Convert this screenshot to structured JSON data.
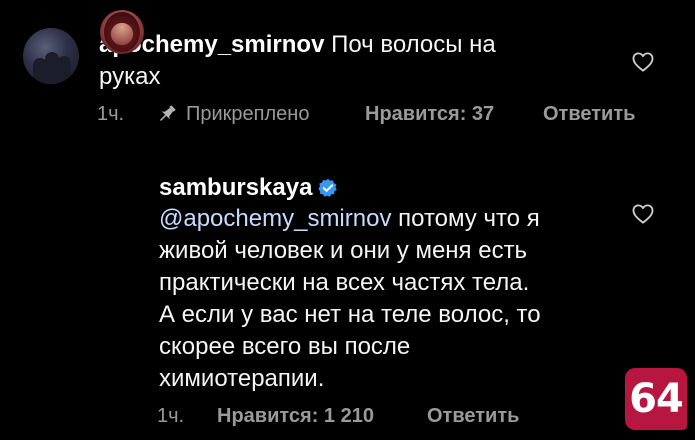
{
  "comment1": {
    "username": "apochemy_smirnov",
    "text_line1": " Поч волосы на",
    "text_line2": "руках",
    "time": "1ч.",
    "pinned_label": "Прикреплено",
    "likes": "Нравится: 37",
    "reply": "Ответить"
  },
  "comment2": {
    "username": "samburskaya",
    "mention": "@apochemy_smirnov",
    "lines": [
      " потому что я",
      "живой человек и они у меня есть",
      "практически на всех частях тела.",
      "А если у вас нет на теле волос, то",
      "скорее всего вы после",
      "химиотерапии."
    ],
    "time": "1ч.",
    "likes": "Нравится: 1 210",
    "reply": "Ответить"
  },
  "badge": {
    "text": "64",
    "color": "#b6163f"
  },
  "icons": {
    "like": "heart-outline-icon",
    "pin": "pin-icon",
    "verified": "verified-badge-icon"
  }
}
